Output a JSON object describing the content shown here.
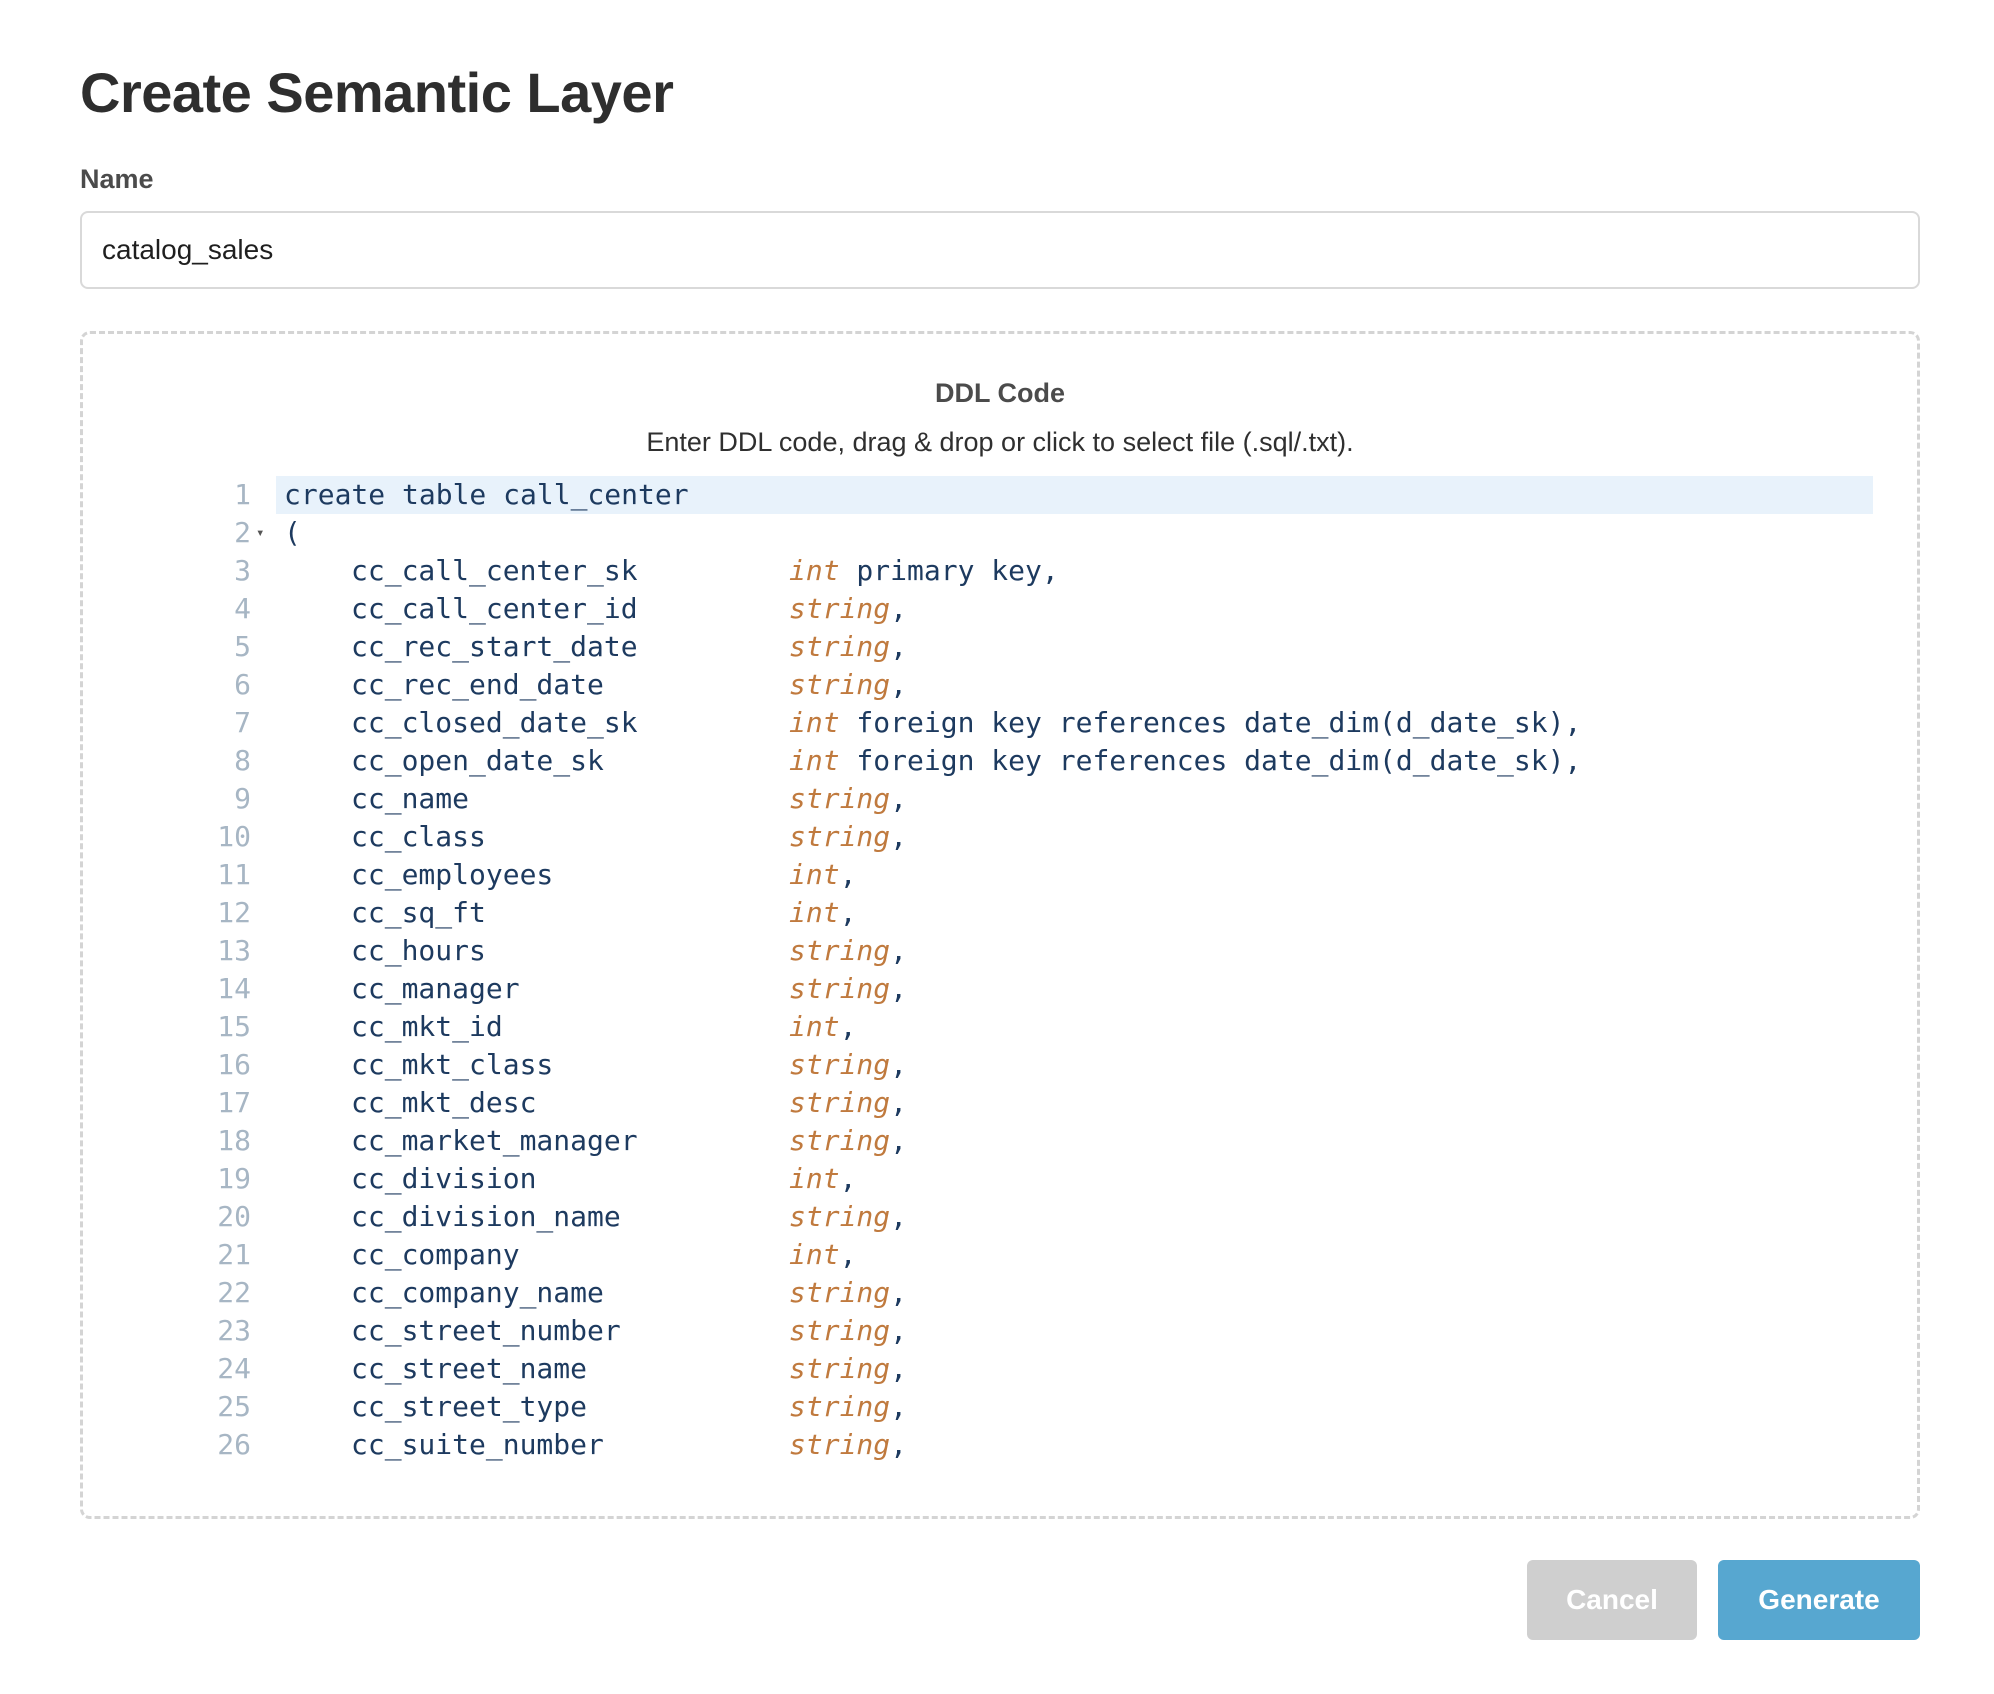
{
  "dialog": {
    "title": "Create Semantic Layer"
  },
  "name_field": {
    "label": "Name",
    "value": "catalog_sales"
  },
  "ddl": {
    "title": "DDL Code",
    "hint": "Enter DDL code, drag & drop or click to select file (.sql/.txt).",
    "line1": "create table call_center",
    "line2": "(",
    "columns": [
      {
        "num": "3",
        "name": "cc_call_center_sk",
        "type": "int",
        "rest": " primary key,"
      },
      {
        "num": "4",
        "name": "cc_call_center_id",
        "type": "string",
        "rest": ","
      },
      {
        "num": "5",
        "name": "cc_rec_start_date",
        "type": "string",
        "rest": ","
      },
      {
        "num": "6",
        "name": "cc_rec_end_date",
        "type": "string",
        "rest": ","
      },
      {
        "num": "7",
        "name": "cc_closed_date_sk",
        "type": "int",
        "rest": " foreign key references date_dim(d_date_sk),"
      },
      {
        "num": "8",
        "name": "cc_open_date_sk",
        "type": "int",
        "rest": " foreign key references date_dim(d_date_sk),"
      },
      {
        "num": "9",
        "name": "cc_name",
        "type": "string",
        "rest": ","
      },
      {
        "num": "10",
        "name": "cc_class",
        "type": "string",
        "rest": ","
      },
      {
        "num": "11",
        "name": "cc_employees",
        "type": "int",
        "rest": ","
      },
      {
        "num": "12",
        "name": "cc_sq_ft",
        "type": "int",
        "rest": ","
      },
      {
        "num": "13",
        "name": "cc_hours",
        "type": "string",
        "rest": ","
      },
      {
        "num": "14",
        "name": "cc_manager",
        "type": "string",
        "rest": ","
      },
      {
        "num": "15",
        "name": "cc_mkt_id",
        "type": "int",
        "rest": ","
      },
      {
        "num": "16",
        "name": "cc_mkt_class",
        "type": "string",
        "rest": ","
      },
      {
        "num": "17",
        "name": "cc_mkt_desc",
        "type": "string",
        "rest": ","
      },
      {
        "num": "18",
        "name": "cc_market_manager",
        "type": "string",
        "rest": ","
      },
      {
        "num": "19",
        "name": "cc_division",
        "type": "int",
        "rest": ","
      },
      {
        "num": "20",
        "name": "cc_division_name",
        "type": "string",
        "rest": ","
      },
      {
        "num": "21",
        "name": "cc_company",
        "type": "int",
        "rest": ","
      },
      {
        "num": "22",
        "name": "cc_company_name",
        "type": "string",
        "rest": ","
      },
      {
        "num": "23",
        "name": "cc_street_number",
        "type": "string",
        "rest": ","
      },
      {
        "num": "24",
        "name": "cc_street_name",
        "type": "string",
        "rest": ","
      },
      {
        "num": "25",
        "name": "cc_street_type",
        "type": "string",
        "rest": ","
      },
      {
        "num": "26",
        "name": "cc_suite_number",
        "type": "string",
        "rest": ","
      }
    ],
    "fold_icon": "caret-down-icon"
  },
  "buttons": {
    "cancel_label": "Cancel",
    "generate_label": "Generate"
  },
  "colors": {
    "generate_bg": "#57a7d0",
    "cancel_bg": "#cfcfcf",
    "type_keyword": "#c07a3e",
    "identifier": "#1d3a5f",
    "line_number": "#a7b6c4",
    "active_line_bg": "#e8f2fb"
  }
}
